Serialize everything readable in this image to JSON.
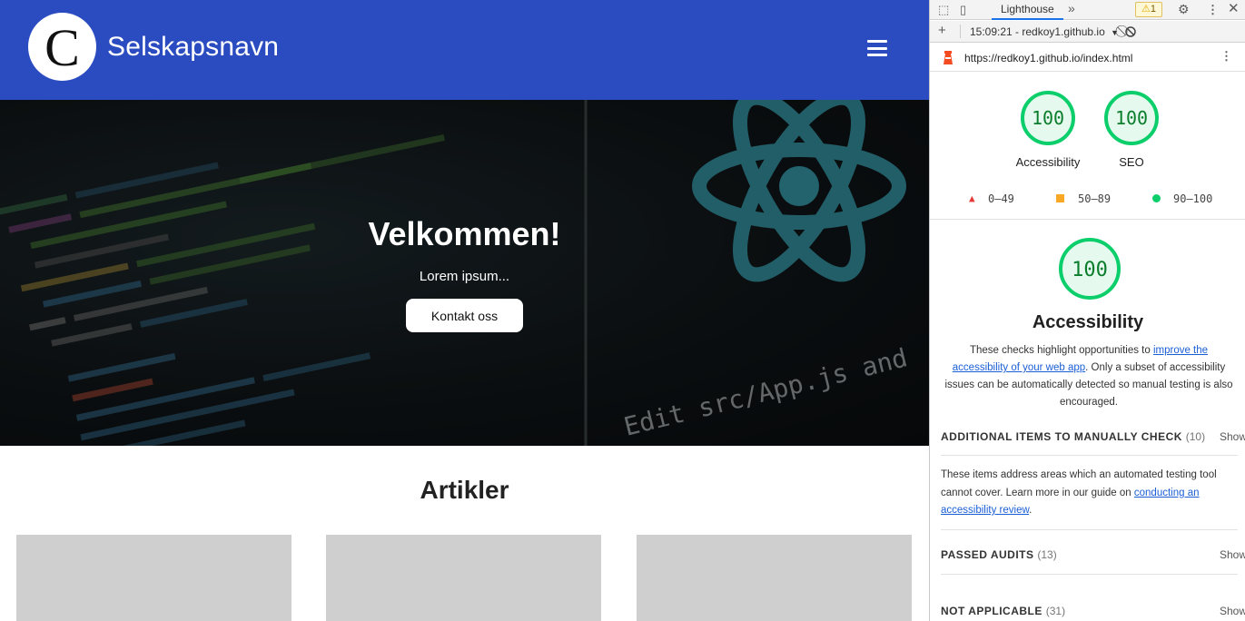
{
  "site": {
    "logo_letter": "C",
    "company_name": "Selskapsnavn",
    "hero": {
      "title": "Velkommen!",
      "subtitle": "Lorem ipsum...",
      "button": "Kontakt oss",
      "code_image_text": "Edit src/App.js and save to rel"
    },
    "articles_heading": "Artikler",
    "article_cards": 3
  },
  "devtools": {
    "active_tab": "Lighthouse",
    "more_tabs": "»",
    "warning_count": "1",
    "report_select": "15:09:21 - redkoy1.github.io",
    "url": "https://redkoy1.github.io/index.html",
    "scores": [
      {
        "label": "Accessibility",
        "value": "100"
      },
      {
        "label": "SEO",
        "value": "100"
      }
    ],
    "legend": [
      {
        "range": "0–49",
        "color": "#e53935"
      },
      {
        "range": "50–89",
        "color": "#f9a825"
      },
      {
        "range": "90–100",
        "color": "#0cce6b"
      }
    ],
    "category": {
      "score": "100",
      "title": "Accessibility",
      "desc_pre": "These checks highlight opportunities to ",
      "desc_link": "improve the accessibility of your web app",
      "desc_post": ". Only a subset of accessibility issues can be automatically detected so manual testing is also encouraged."
    },
    "groups": [
      {
        "title": "ADDITIONAL ITEMS TO MANUALLY CHECK",
        "count": "(10)",
        "show": "Show"
      },
      {
        "title": "PASSED AUDITS",
        "count": "(13)",
        "show": "Show"
      },
      {
        "title": "NOT APPLICABLE",
        "count": "(31)",
        "show": "Show"
      }
    ],
    "manual": {
      "text_pre": "These items address areas which an automated testing tool cannot cover. Learn more in our guide on ",
      "link": "conducting an accessibility review",
      "text_post": "."
    },
    "colors": {
      "pass": "#0cce6b",
      "pass_text": "#0a7d2c",
      "link": "#1a5fd6",
      "header_blue": "#2b4cc0"
    }
  }
}
